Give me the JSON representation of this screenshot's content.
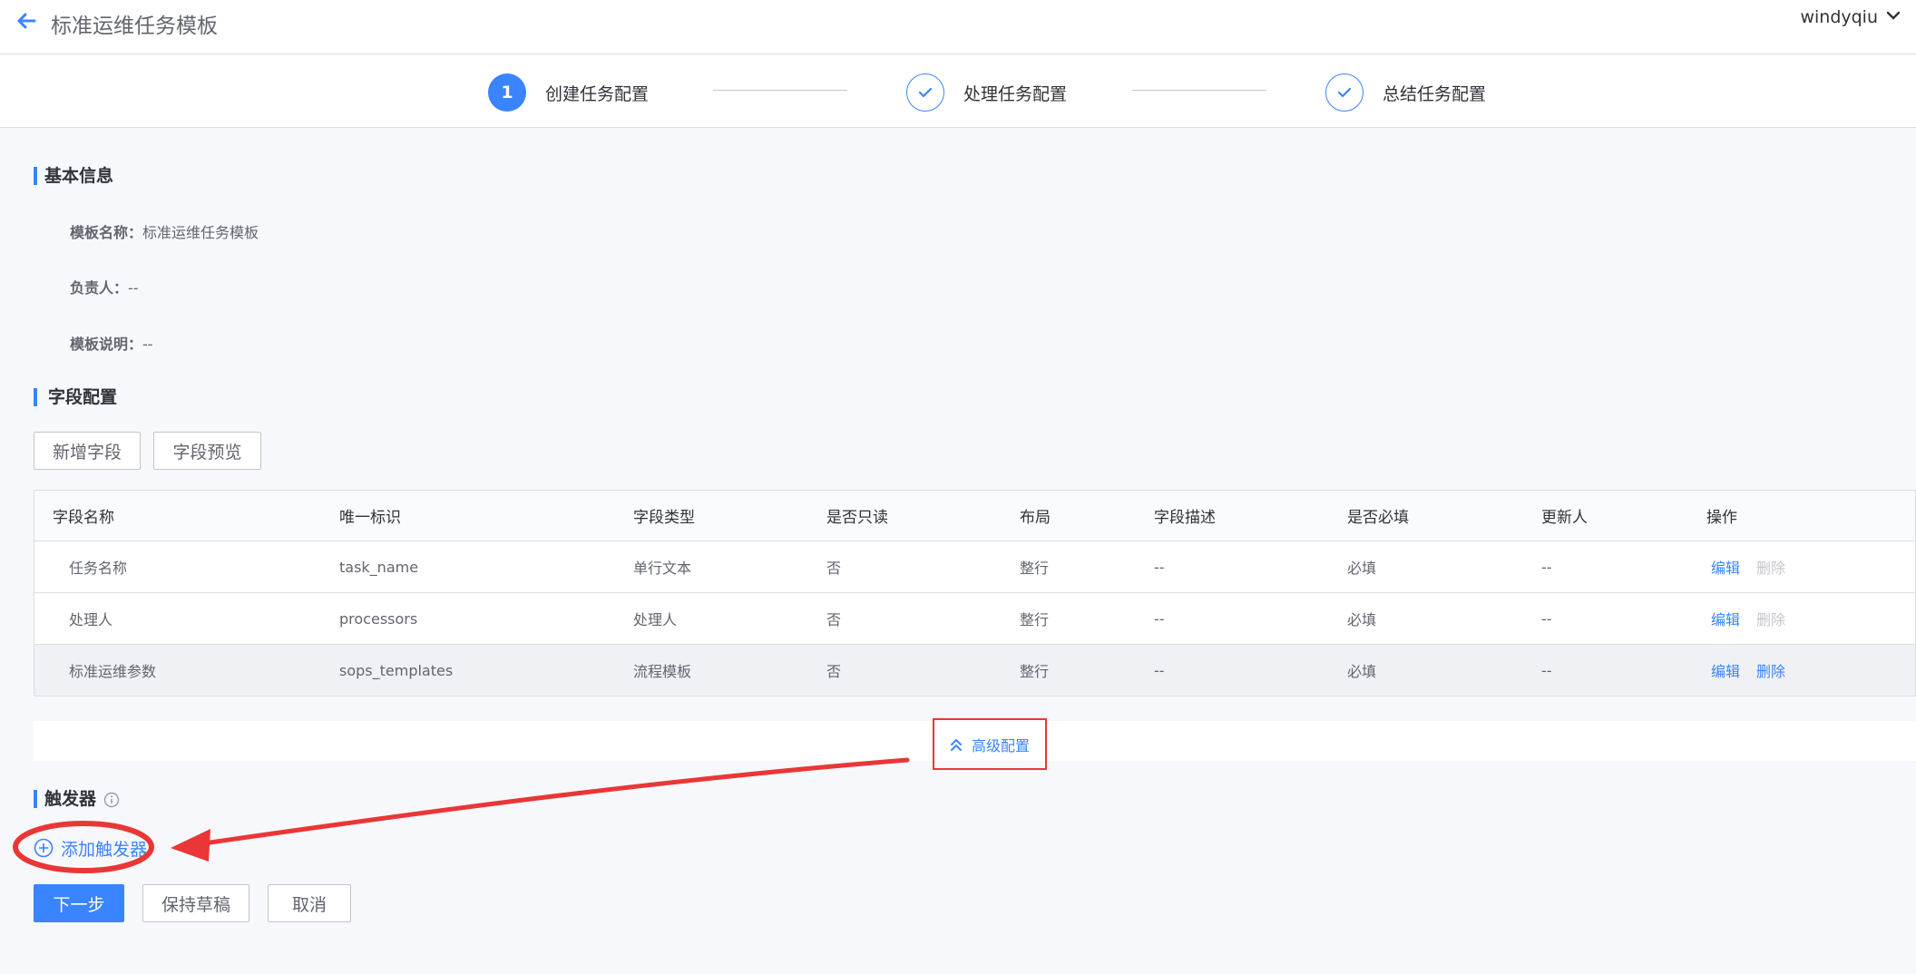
{
  "header": {
    "title": "标准运维任务模板",
    "back_icon": "arrow-left-icon",
    "user": "windyqiu",
    "user_menu_icon": "chevron-down-icon"
  },
  "steps": [
    {
      "number": "1",
      "label": "创建任务配置",
      "state": "active"
    },
    {
      "label": "处理任务配置",
      "state": "done",
      "icon": "check-icon"
    },
    {
      "label": "总结任务配置",
      "state": "done",
      "icon": "check-icon"
    }
  ],
  "basic_info": {
    "title": "基本信息",
    "rows": [
      {
        "label": "模板名称：",
        "value": "标准运维任务模板"
      },
      {
        "label": "负责人：",
        "value": "--"
      },
      {
        "label": "模板说明：",
        "value": "--"
      }
    ]
  },
  "fields": {
    "title": "字段配置",
    "add_button": "新增字段",
    "preview_button": "字段预览",
    "columns": [
      "字段名称",
      "唯一标识",
      "字段类型",
      "是否只读",
      "布局",
      "字段描述",
      "是否必填",
      "更新人",
      "操作"
    ],
    "rows": [
      {
        "name": "任务名称",
        "key": "task_name",
        "type": "单行文本",
        "readonly": "否",
        "layout": "整行",
        "desc": "--",
        "required": "必填",
        "updater": "--",
        "edit": "编辑",
        "delete": "删除",
        "delete_enabled": false
      },
      {
        "name": "处理人",
        "key": "processors",
        "type": "处理人",
        "readonly": "否",
        "layout": "整行",
        "desc": "--",
        "required": "必填",
        "updater": "--",
        "edit": "编辑",
        "delete": "删除",
        "delete_enabled": false
      },
      {
        "name": "标准运维参数",
        "key": "sops_templates",
        "type": "流程模板",
        "readonly": "否",
        "layout": "整行",
        "desc": "--",
        "required": "必填",
        "updater": "--",
        "edit": "编辑",
        "delete": "删除",
        "delete_enabled": true
      }
    ]
  },
  "advanced": {
    "label": "高级配置",
    "icon": "double-chevron-up-icon"
  },
  "trigger": {
    "title": "触发器",
    "info_icon": "info-circle-icon",
    "add_label": "添加触发器",
    "add_icon": "plus-circle-icon"
  },
  "footer": {
    "next": "下一步",
    "save_draft": "保持草稿",
    "cancel": "取消"
  },
  "colors": {
    "primary": "#3a84ff",
    "annotation": "#ea3636",
    "disabled": "#c4c6cc"
  }
}
